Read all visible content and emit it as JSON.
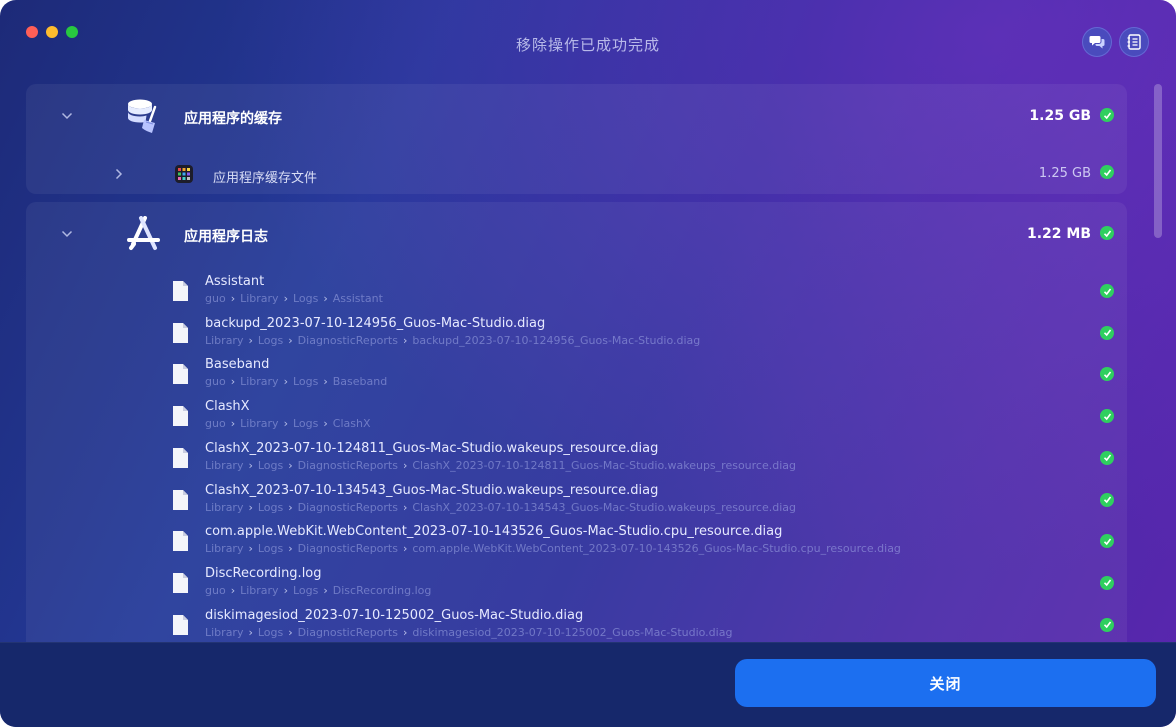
{
  "window": {
    "title": "移除操作已成功完成"
  },
  "toolbar": {
    "buttons": [
      {
        "icon": "chat-icon"
      },
      {
        "icon": "log-icon"
      }
    ]
  },
  "categories": [
    {
      "title": "应用程序的缓存",
      "size": "1.25 GB",
      "icon": "database-broom-icon",
      "expanded": true,
      "subitems": [
        {
          "title": "应用程序缓存文件",
          "size": "1.25 GB",
          "icon": "grid-app-icon",
          "expanded": false
        }
      ]
    },
    {
      "title": "应用程序日志",
      "size": "1.22 MB",
      "icon": "app-store-icon",
      "expanded": true,
      "files": [
        {
          "name": "Assistant",
          "path": [
            "guo",
            "Library",
            "Logs",
            "Assistant"
          ]
        },
        {
          "name": "backupd_2023-07-10-124956_Guos-Mac-Studio.diag",
          "path": [
            "Library",
            "Logs",
            "DiagnosticReports",
            "backupd_2023-07-10-124956_Guos-Mac-Studio.diag"
          ]
        },
        {
          "name": "Baseband",
          "path": [
            "guo",
            "Library",
            "Logs",
            "Baseband"
          ]
        },
        {
          "name": "ClashX",
          "path": [
            "guo",
            "Library",
            "Logs",
            "ClashX"
          ]
        },
        {
          "name": "ClashX_2023-07-10-124811_Guos-Mac-Studio.wakeups_resource.diag",
          "path": [
            "Library",
            "Logs",
            "DiagnosticReports",
            "ClashX_2023-07-10-124811_Guos-Mac-Studio.wakeups_resource.diag"
          ]
        },
        {
          "name": "ClashX_2023-07-10-134543_Guos-Mac-Studio.wakeups_resource.diag",
          "path": [
            "Library",
            "Logs",
            "DiagnosticReports",
            "ClashX_2023-07-10-134543_Guos-Mac-Studio.wakeups_resource.diag"
          ]
        },
        {
          "name": "com.apple.WebKit.WebContent_2023-07-10-143526_Guos-Mac-Studio.cpu_resource.diag",
          "path": [
            "Library",
            "Logs",
            "DiagnosticReports",
            "com.apple.WebKit.WebContent_2023-07-10-143526_Guos-Mac-Studio.cpu_resource.diag"
          ]
        },
        {
          "name": "DiscRecording.log",
          "path": [
            "guo",
            "Library",
            "Logs",
            "DiscRecording.log"
          ]
        },
        {
          "name": "diskimagesiod_2023-07-10-125002_Guos-Mac-Studio.diag",
          "path": [
            "Library",
            "Logs",
            "DiagnosticReports",
            "diskimagesiod_2023-07-10-125002_Guos-Mac-Studio.diag"
          ]
        }
      ]
    }
  ],
  "footer": {
    "close_label": "关闭"
  },
  "colors": {
    "accent": "#1c6ff0",
    "success": "#2fcf5f"
  }
}
